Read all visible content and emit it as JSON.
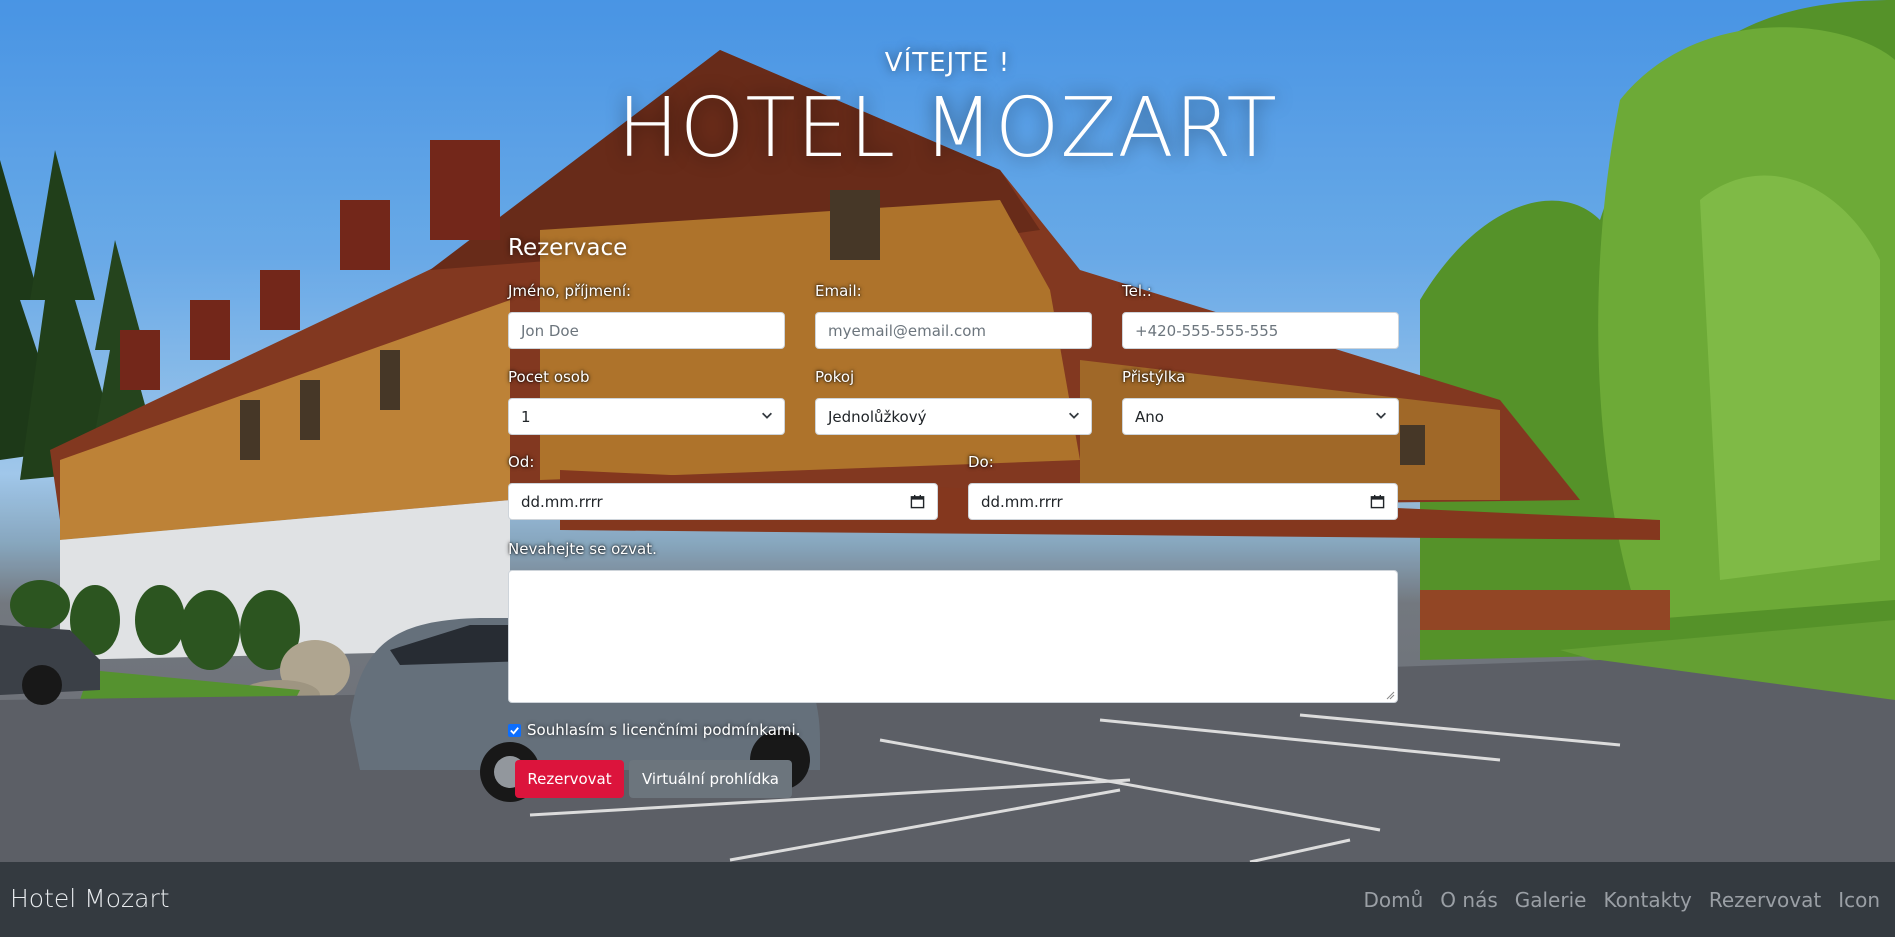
{
  "hero": {
    "welcome": "VÍTEJTE !",
    "title": "HOTEL MOZART"
  },
  "form": {
    "title": "Rezervace",
    "name_label": "Jméno, příjmení:",
    "name_placeholder": "Jon Doe",
    "email_label": "Email:",
    "email_placeholder": "myemail@email.com",
    "phone_label": "Tel.:",
    "phone_placeholder": "+420-555-555-555",
    "persons_label": "Pocet osob",
    "persons_value": "1",
    "room_label": "Pokoj",
    "room_value": "Jednolůžkový",
    "extrabed_label": "Přistýlka",
    "extrabed_value": "Ano",
    "from_label": "Od:",
    "from_placeholder": "dd.mm.rrrr",
    "to_label": "Do:",
    "to_placeholder": "dd.mm.rrrr",
    "message_label": "Nevahejte se ozvat.",
    "consent_label": "Souhlasím s licenčními podmínkami.",
    "consent_checked": true,
    "submit_label": "Rezervovat",
    "tour_label": "Virtuální prohlídka"
  },
  "colors": {
    "primary_button": "#dc143c",
    "secondary_button": "#6c757d",
    "navbar": "#343a40",
    "checkbox": "#0d6efd"
  },
  "navbar": {
    "brand": "Hotel Mozart",
    "links": [
      "Domů",
      "O nás",
      "Galerie",
      "Kontakty",
      "Rezervovat",
      "Icon"
    ]
  }
}
